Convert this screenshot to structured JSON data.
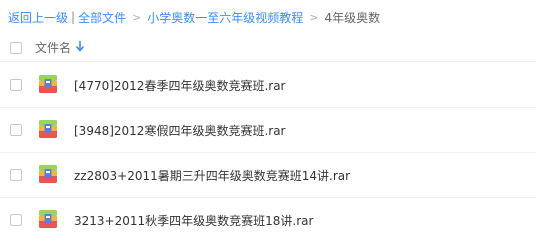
{
  "breadcrumb": {
    "back": "返回上一级",
    "separator": "|",
    "all_files": "全部文件",
    "arrow": ">",
    "level2": "小学奥数一至六年级视频教程",
    "current": "4年级奥数"
  },
  "header": {
    "name_column": "文件名",
    "sort_icon": "arrow-down-icon",
    "sort_color": "#3b8cff"
  },
  "files": [
    {
      "name": "[4770]2012春季四年级奥数竞赛班.rar",
      "icon": "rar-archive-icon"
    },
    {
      "name": "[3948]2012寒假四年级奥数竞赛班.rar",
      "icon": "rar-archive-icon"
    },
    {
      "name": "zz2803+2011暑期三升四年级奥数竞赛班14讲.rar",
      "icon": "rar-archive-icon"
    },
    {
      "name": "3213+2011秋季四年级奥数竞赛班18讲.rar",
      "icon": "rar-archive-icon"
    }
  ],
  "colors": {
    "link": "#3b8cff",
    "text": "#333333",
    "muted": "#666666"
  }
}
